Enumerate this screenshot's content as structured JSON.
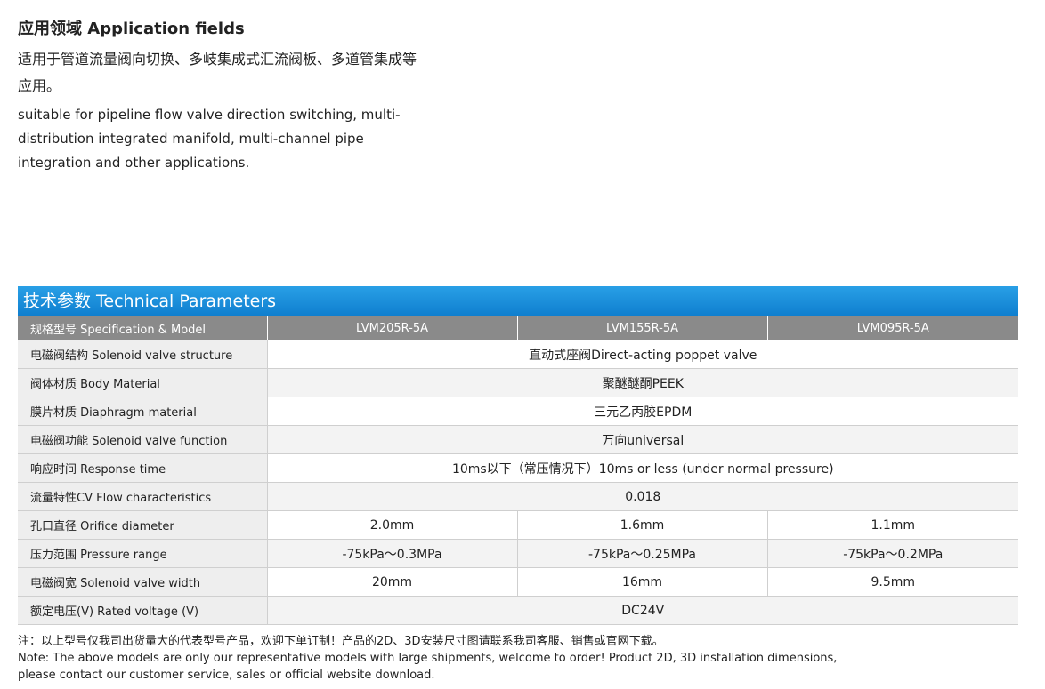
{
  "application": {
    "title": "应用领域 Application fields",
    "text_cn": "适用于管道流量阀向切换、多岐集成式汇流阀板、多道管集成等应用。",
    "text_en": "suitable for pipeline flow valve direction switching, multi-distribution integrated manifold, multi-channel pipe integration and other applications."
  },
  "tech": {
    "title": "技术参数  Technical Parameters",
    "header_label": "规格型号  Specification & Model",
    "models": [
      "LVM205R-5A",
      "LVM155R-5A",
      "LVM095R-5A"
    ],
    "rows_shared": [
      {
        "label": "电磁阀结构  Solenoid valve structure",
        "value": "直动式座阀Direct-acting poppet valve"
      },
      {
        "label": "阀体材质  Body Material",
        "value": "聚醚醚酮PEEK"
      },
      {
        "label": "膜片材质  Diaphragm material",
        "value": "三元乙丙胶EPDM"
      },
      {
        "label": "电磁阀功能  Solenoid valve function",
        "value": "万向universal"
      },
      {
        "label": "响应时间  Response time",
        "value": "10ms以下（常压情况下）10ms or less (under normal pressure)"
      },
      {
        "label": "流量特性CV  Flow characteristics",
        "value": "0.018"
      }
    ],
    "rows_split": [
      {
        "label": "孔口直径  Orifice diameter",
        "values": [
          "2.0mm",
          "1.6mm",
          "1.1mm"
        ]
      },
      {
        "label": "压力范围  Pressure range",
        "values": [
          "-75kPa～0.3MPa",
          "-75kPa～0.25MPa",
          "-75kPa～0.2MPa"
        ]
      },
      {
        "label": "电磁阀宽  Solenoid valve width",
        "values": [
          "20mm",
          "16mm",
          "9.5mm"
        ]
      }
    ],
    "row_last": {
      "label": "额定电压(V)  Rated voltage (V)",
      "value": "DC24V"
    }
  },
  "notes": {
    "cn": "注：以上型号仅我司出货量大的代表型号产品，欢迎下单订制！产品的2D、3D安装尺寸图请联系我司客服、销售或官网下载。",
    "en1": "Note: The above models are only our representative models with large shipments, welcome to order! Product 2D, 3D installation dimensions,",
    "en2": "please contact our customer service, sales or official website download."
  }
}
